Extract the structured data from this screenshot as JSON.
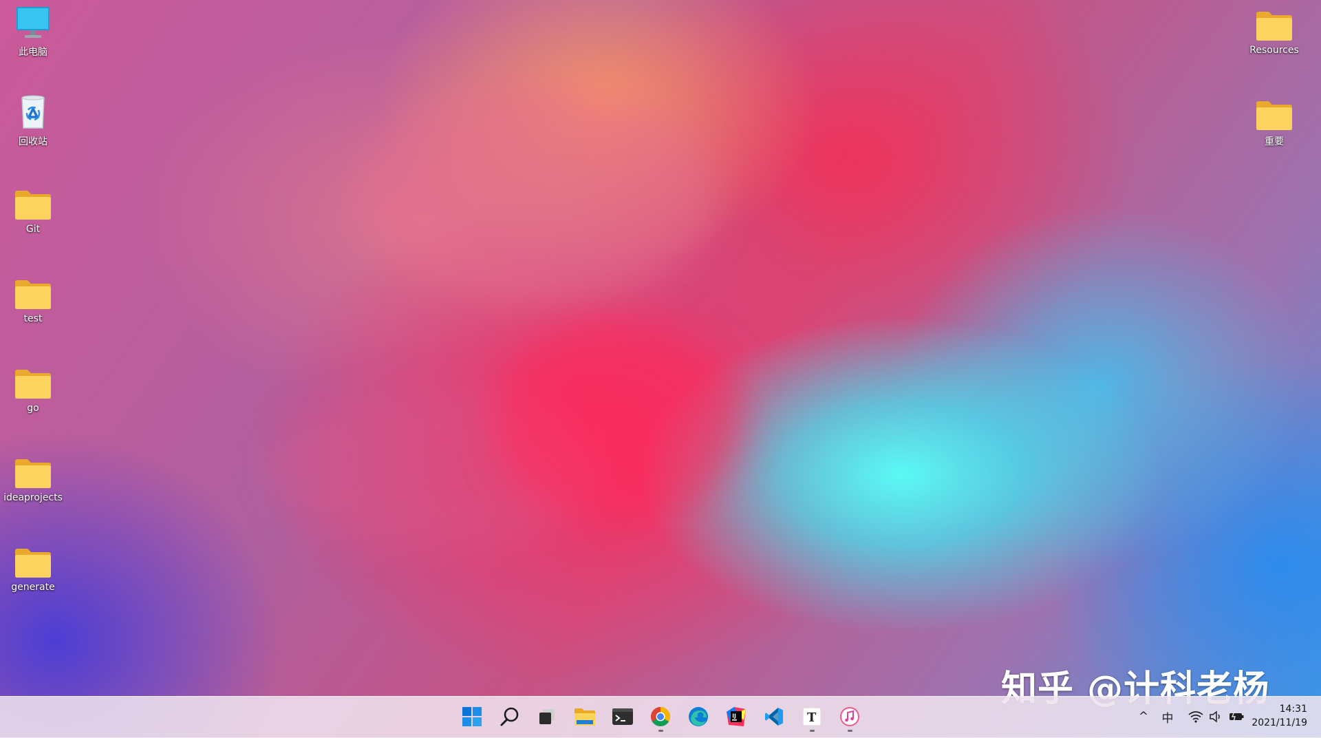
{
  "desktop": {
    "left_icons": [
      {
        "label": "此电脑",
        "icon": "computer-monitor-icon"
      },
      {
        "label": "回收站",
        "icon": "recycle-bin-icon"
      },
      {
        "label": "Git",
        "icon": "folder-icon"
      },
      {
        "label": "test",
        "icon": "folder-icon"
      },
      {
        "label": "go",
        "icon": "folder-icon"
      },
      {
        "label": "ideaprojects",
        "icon": "folder-icon"
      },
      {
        "label": "generate",
        "icon": "folder-icon"
      }
    ],
    "right_icons": [
      {
        "label": "Resources",
        "icon": "folder-icon"
      },
      {
        "label": "重要",
        "icon": "folder-icon"
      }
    ]
  },
  "watermark": {
    "text": "知乎 @计科老杨"
  },
  "taskbar": {
    "apps": [
      {
        "name": "start",
        "icon": "windows-start-icon",
        "running": false
      },
      {
        "name": "search",
        "icon": "search-icon",
        "running": false
      },
      {
        "name": "task-view",
        "icon": "task-view-icon",
        "running": false
      },
      {
        "name": "file-explorer",
        "icon": "file-explorer-icon",
        "running": false
      },
      {
        "name": "terminal",
        "icon": "terminal-icon",
        "running": false
      },
      {
        "name": "chrome",
        "icon": "chrome-icon",
        "running": true
      },
      {
        "name": "edge",
        "icon": "edge-icon",
        "running": false
      },
      {
        "name": "intellij",
        "icon": "intellij-idea-icon",
        "running": false
      },
      {
        "name": "vscode",
        "icon": "vscode-icon",
        "running": false
      },
      {
        "name": "typora",
        "icon": "typora-icon",
        "running": true
      },
      {
        "name": "itunes",
        "icon": "itunes-icon",
        "running": true
      }
    ],
    "tray": {
      "chevron": "^",
      "ime_label": "中",
      "wifi_icon": "wifi-icon",
      "volume_icon": "volume-icon",
      "battery_icon": "battery-icon"
    },
    "clock": {
      "time": "14:31",
      "date": "2021/11/19"
    }
  },
  "colors": {
    "folder_yellow": "#f7c948",
    "folder_back": "#e9a92c",
    "taskbar_bg": "#eee2ee",
    "accent_blue": "#1a73e8"
  }
}
